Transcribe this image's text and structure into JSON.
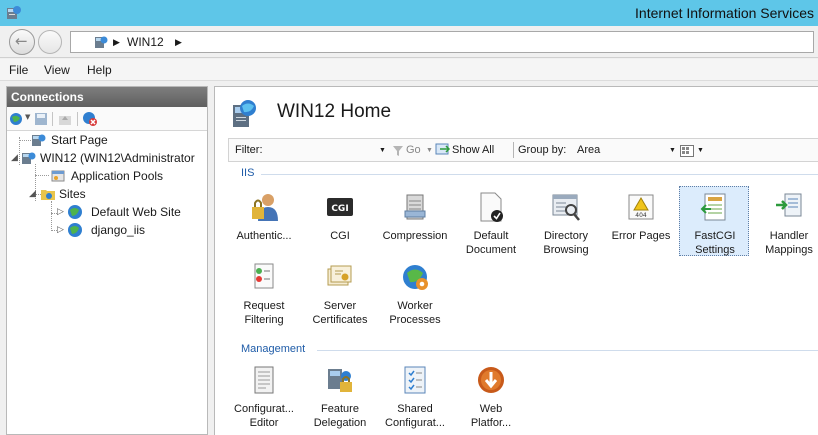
{
  "window": {
    "title": "Internet Information Services"
  },
  "address": {
    "crumbs": [
      "WIN12"
    ]
  },
  "menu": {
    "items": [
      "File",
      "View",
      "Help"
    ]
  },
  "connections": {
    "header": "Connections",
    "tree": [
      {
        "label": "Start Page"
      },
      {
        "label": "WIN12 (WIN12\\Administrator"
      },
      {
        "label": "Application Pools"
      },
      {
        "label": "Sites"
      },
      {
        "label": "Default Web Site"
      },
      {
        "label": "django_iis"
      }
    ]
  },
  "main": {
    "title": "WIN12 Home",
    "filter": {
      "label": "Filter:",
      "go": "Go",
      "show_all": "Show All",
      "group_by_label": "Group by:",
      "group_by_value": "Area"
    },
    "groups": [
      {
        "name": "IIS",
        "features": [
          {
            "line1": "Authentic...",
            "line2": ""
          },
          {
            "line1": "CGI",
            "line2": ""
          },
          {
            "line1": "Compression",
            "line2": ""
          },
          {
            "line1": "Default",
            "line2": "Document"
          },
          {
            "line1": "Directory",
            "line2": "Browsing"
          },
          {
            "line1": "Error Pages",
            "line2": ""
          },
          {
            "line1": "FastCGI",
            "line2": "Settings"
          },
          {
            "line1": "Handler",
            "line2": "Mappings"
          },
          {
            "line1": "Request",
            "line2": "Filtering"
          },
          {
            "line1": "Server",
            "line2": "Certificates"
          },
          {
            "line1": "Worker",
            "line2": "Processes"
          }
        ]
      },
      {
        "name": "Management",
        "features": [
          {
            "line1": "Configurat...",
            "line2": "Editor"
          },
          {
            "line1": "Feature",
            "line2": "Delegation"
          },
          {
            "line1": "Shared",
            "line2": "Configurat..."
          },
          {
            "line1": "Web",
            "line2": "Platfor..."
          }
        ]
      }
    ],
    "cgi_icon_text": "CGI",
    "error_icon_text": "404"
  }
}
